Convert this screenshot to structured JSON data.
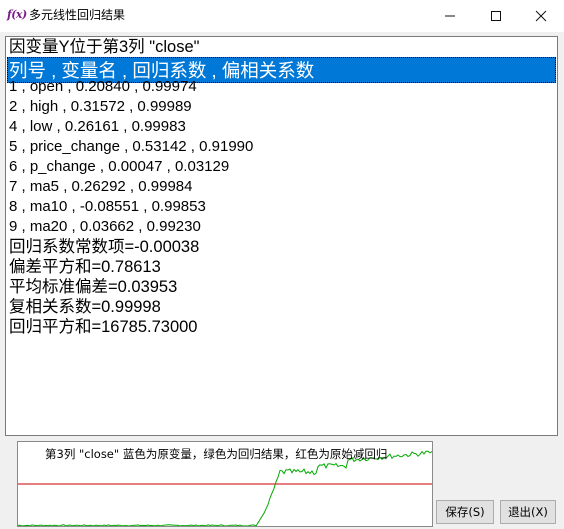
{
  "window": {
    "icon_text": "f(x)",
    "title": "多元线性回归结果"
  },
  "results": {
    "lines": [
      {
        "text": "因变量Y位于第3列 \"close\"",
        "style": "big"
      },
      {
        "text": "列号 , 变量名 , 回归系数 , 偏相关系数",
        "style": "header"
      },
      {
        "text": "1 , open , 0.20840 , 0.99974",
        "style": "small"
      },
      {
        "text": "2 , high , 0.31572 , 0.99989",
        "style": "small"
      },
      {
        "text": "4 , low , 0.26161 , 0.99983",
        "style": "small"
      },
      {
        "text": "5 , price_change , 0.53142 , 0.91990",
        "style": "small"
      },
      {
        "text": "6 , p_change , 0.00047 , 0.03129",
        "style": "small"
      },
      {
        "text": "7 , ma5 , 0.26292 , 0.99984",
        "style": "small"
      },
      {
        "text": "8 , ma10 , -0.08551 , 0.99853",
        "style": "small"
      },
      {
        "text": "9 , ma20 , 0.03662 , 0.99230",
        "style": "small"
      },
      {
        "text": "回归系数常数项=-0.00038",
        "style": "big"
      },
      {
        "text": "偏差平方和=0.78613",
        "style": "big"
      },
      {
        "text": "平均标准偏差=0.03953",
        "style": "big"
      },
      {
        "text": "复相关系数=0.99998",
        "style": "big"
      },
      {
        "text": "回归平方和=16785.73000",
        "style": "big"
      }
    ]
  },
  "preview": {
    "caption": "第3列 \"close\" 蓝色为原变量，绿色为回归结果，红色为原始减回归",
    "colors": {
      "original": "#0000ff",
      "regression": "#00aa00",
      "residual": "#cc0000"
    }
  },
  "buttons": {
    "save": "保存(S)",
    "exit": "退出(X)"
  }
}
